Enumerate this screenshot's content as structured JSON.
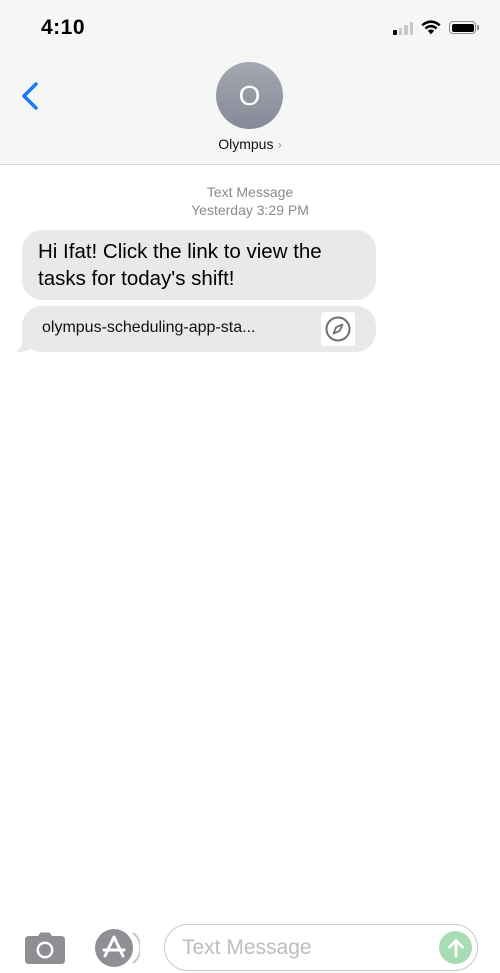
{
  "status_bar": {
    "time": "4:10",
    "signal_bars_on": 1,
    "signal_bars_total": 4
  },
  "header": {
    "avatar_initial": "O",
    "contact_name": "Olympus",
    "chevron": "›"
  },
  "thread": {
    "service_label": "Text Message",
    "timestamp": "Yesterday 3:29 PM",
    "messages": [
      {
        "type": "text",
        "text": "Hi Ifat! Click the link to view the tasks for today's shift!"
      },
      {
        "type": "link",
        "text": "olympus-scheduling-app-sta...",
        "icon": "compass-icon"
      }
    ]
  },
  "composer": {
    "placeholder": "Text Message",
    "value": ""
  },
  "colors": {
    "accent": "#1a7cf3",
    "bubble": "#e9e9eb",
    "send_disabled": "#a8dcb4"
  }
}
